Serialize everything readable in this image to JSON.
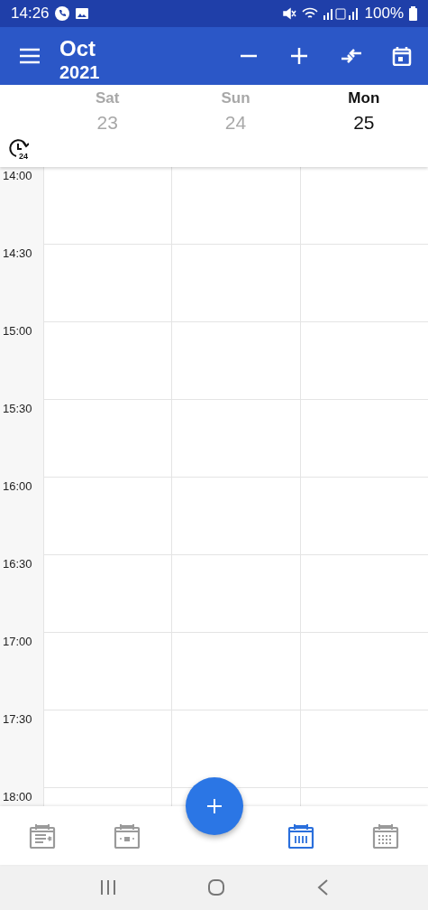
{
  "status_bar": {
    "time": "14:26",
    "battery": "100%"
  },
  "app_bar": {
    "month": "Oct",
    "year": "2021"
  },
  "days": [
    {
      "weekday": "Sat",
      "date": "23",
      "selected": false
    },
    {
      "weekday": "Sun",
      "date": "24",
      "selected": false
    },
    {
      "weekday": "Mon",
      "date": "25",
      "selected": true
    }
  ],
  "time_format_badge": "24",
  "time_slots": [
    "14:00",
    "14:30",
    "15:00",
    "15:30",
    "16:00",
    "16:30",
    "17:00",
    "17:30",
    "18:00"
  ],
  "bottom_nav": [
    {
      "kind": "agenda",
      "selected": false
    },
    {
      "kind": "day",
      "selected": false
    },
    {
      "kind": "week",
      "selected": true
    },
    {
      "kind": "month",
      "selected": false
    }
  ]
}
